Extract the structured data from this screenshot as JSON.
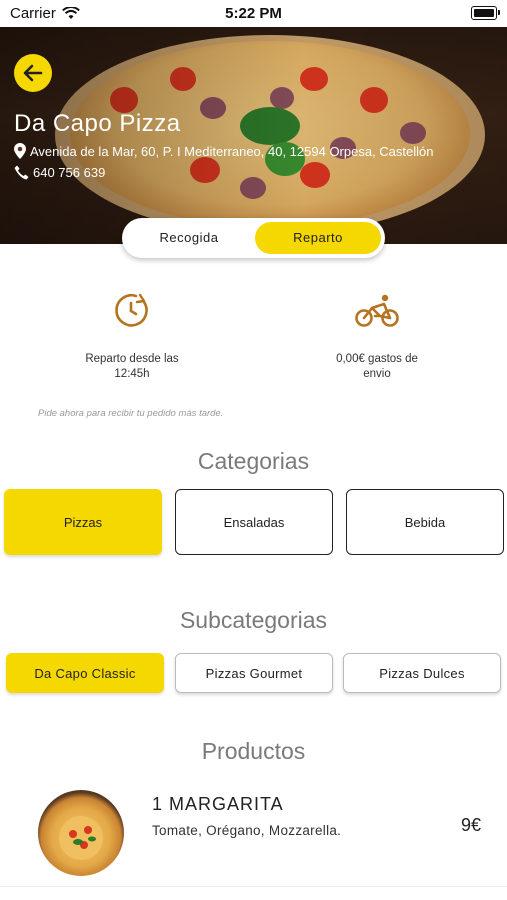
{
  "status_bar": {
    "carrier": "Carrier",
    "time": "5:22 PM"
  },
  "restaurant": {
    "name": "Da Capo Pizza",
    "address": "Avenida de la Mar, 60, P. I Mediterraneo, 40, 12594 Orpesa, Castellón",
    "phone": "640 756 639"
  },
  "mode_toggle": {
    "options": [
      "Recogida",
      "Reparto"
    ],
    "selected": "Reparto"
  },
  "delivery_info": {
    "time_text": "Reparto desde las 12:45h",
    "cost_text": "0,00€ gastos de envio",
    "note": "Pide ahora para recibir tu pedido más tarde."
  },
  "categories": {
    "title": "Categorias",
    "items": [
      "Pizzas",
      "Ensaladas",
      "Bebida"
    ],
    "selected": "Pizzas"
  },
  "subcategories": {
    "title": "Subcategorias",
    "items": [
      "Da Capo Classic",
      "Pizzas Gourmet",
      "Pizzas Dulces"
    ],
    "selected": "Da Capo Classic"
  },
  "products": {
    "title": "Productos",
    "items": [
      {
        "name": "1 MARGARITA",
        "description": "Tomate, Orégano, Mozzarella.",
        "price": "9€"
      }
    ]
  },
  "colors": {
    "accent": "#f5d800",
    "icon_brown": "#b5731f"
  }
}
